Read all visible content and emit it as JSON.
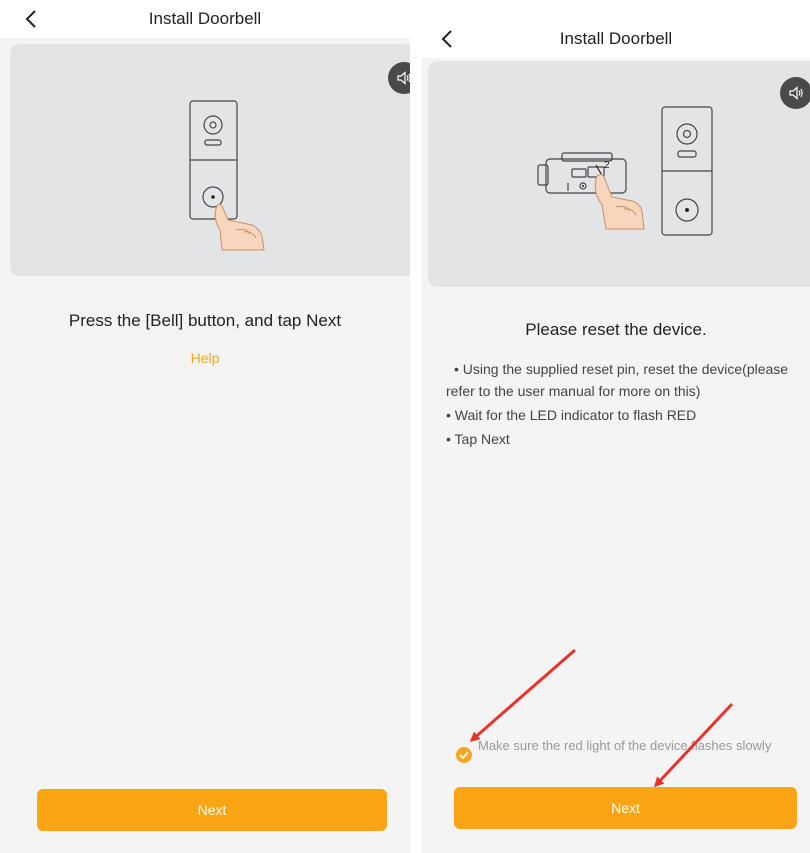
{
  "left": {
    "header": {
      "title": "Install Doorbell"
    },
    "instruction": "Press the [Bell] button, and tap Next",
    "help_label": "Help",
    "next_label": "Next"
  },
  "right": {
    "header": {
      "title": "Install Doorbell"
    },
    "instruction": "Please reset the device.",
    "steps": [
      "• Using the supplied reset pin, reset the device(please refer to the user manual for more on this)",
      "• Wait for the LED indicator to flash RED",
      "• Tap Next"
    ],
    "confirm_label": "Make sure the red light of the device flashes slowly",
    "confirm_checked": true,
    "next_label": "Next",
    "device_label_numbers": [
      "1",
      "2"
    ]
  },
  "icons": {
    "back": "chevron-left-icon",
    "sound": "speaker-icon",
    "check": "check-icon",
    "annotation": "red-arrow"
  },
  "colors": {
    "accent": "#fba514",
    "help_link": "#f5a623",
    "annotation_arrow": "#e8322b",
    "illustration_bg": "#e3e4e6",
    "page_bg": "#f4f4f4"
  }
}
